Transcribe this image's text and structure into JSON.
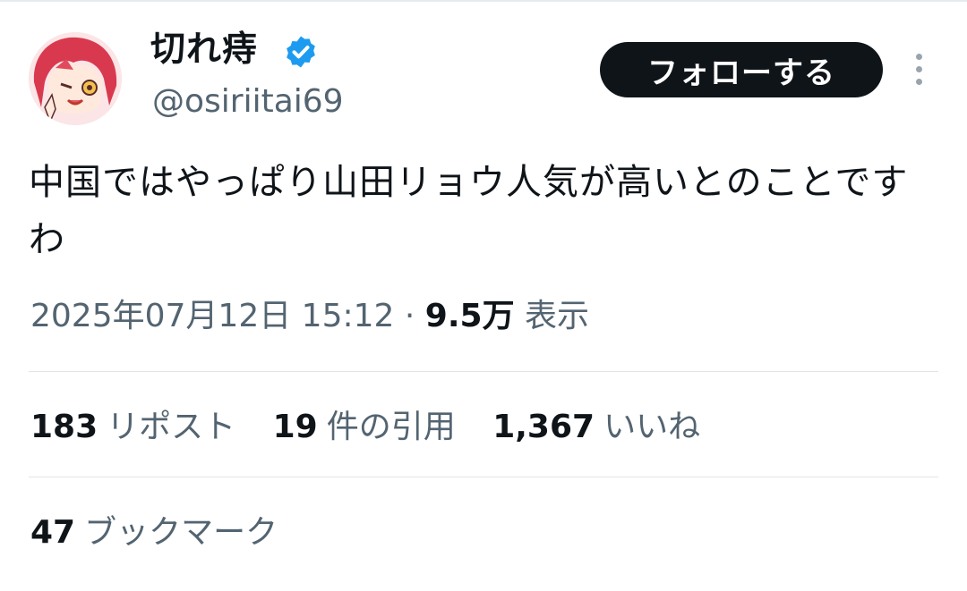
{
  "user": {
    "display_name": "切れ痔",
    "handle": "@osiriitai69",
    "verified_icon": "verified-badge-icon",
    "verified_color": "#1d9bf0"
  },
  "actions": {
    "follow_label": "フォローする",
    "more_icon": "more-vertical-icon"
  },
  "tweet": {
    "text": "中国ではやっぱり山田リョウ人気が高いとのことですわ",
    "timestamp": "2025年07月12日 15:12",
    "separator": "·",
    "views_count": "9.5万",
    "views_label": "表示"
  },
  "stats": {
    "retweets_count": "183",
    "retweets_label": "リポスト",
    "quotes_count": "19",
    "quotes_label": "件の引用",
    "likes_count": "1,367",
    "likes_label": "いいね",
    "bookmarks_count": "47",
    "bookmarks_label": "ブックマーク"
  },
  "colors": {
    "text_primary": "#0f1419",
    "text_secondary": "#536471",
    "button_bg": "#0f1419",
    "divider": "#e1e5e8"
  }
}
